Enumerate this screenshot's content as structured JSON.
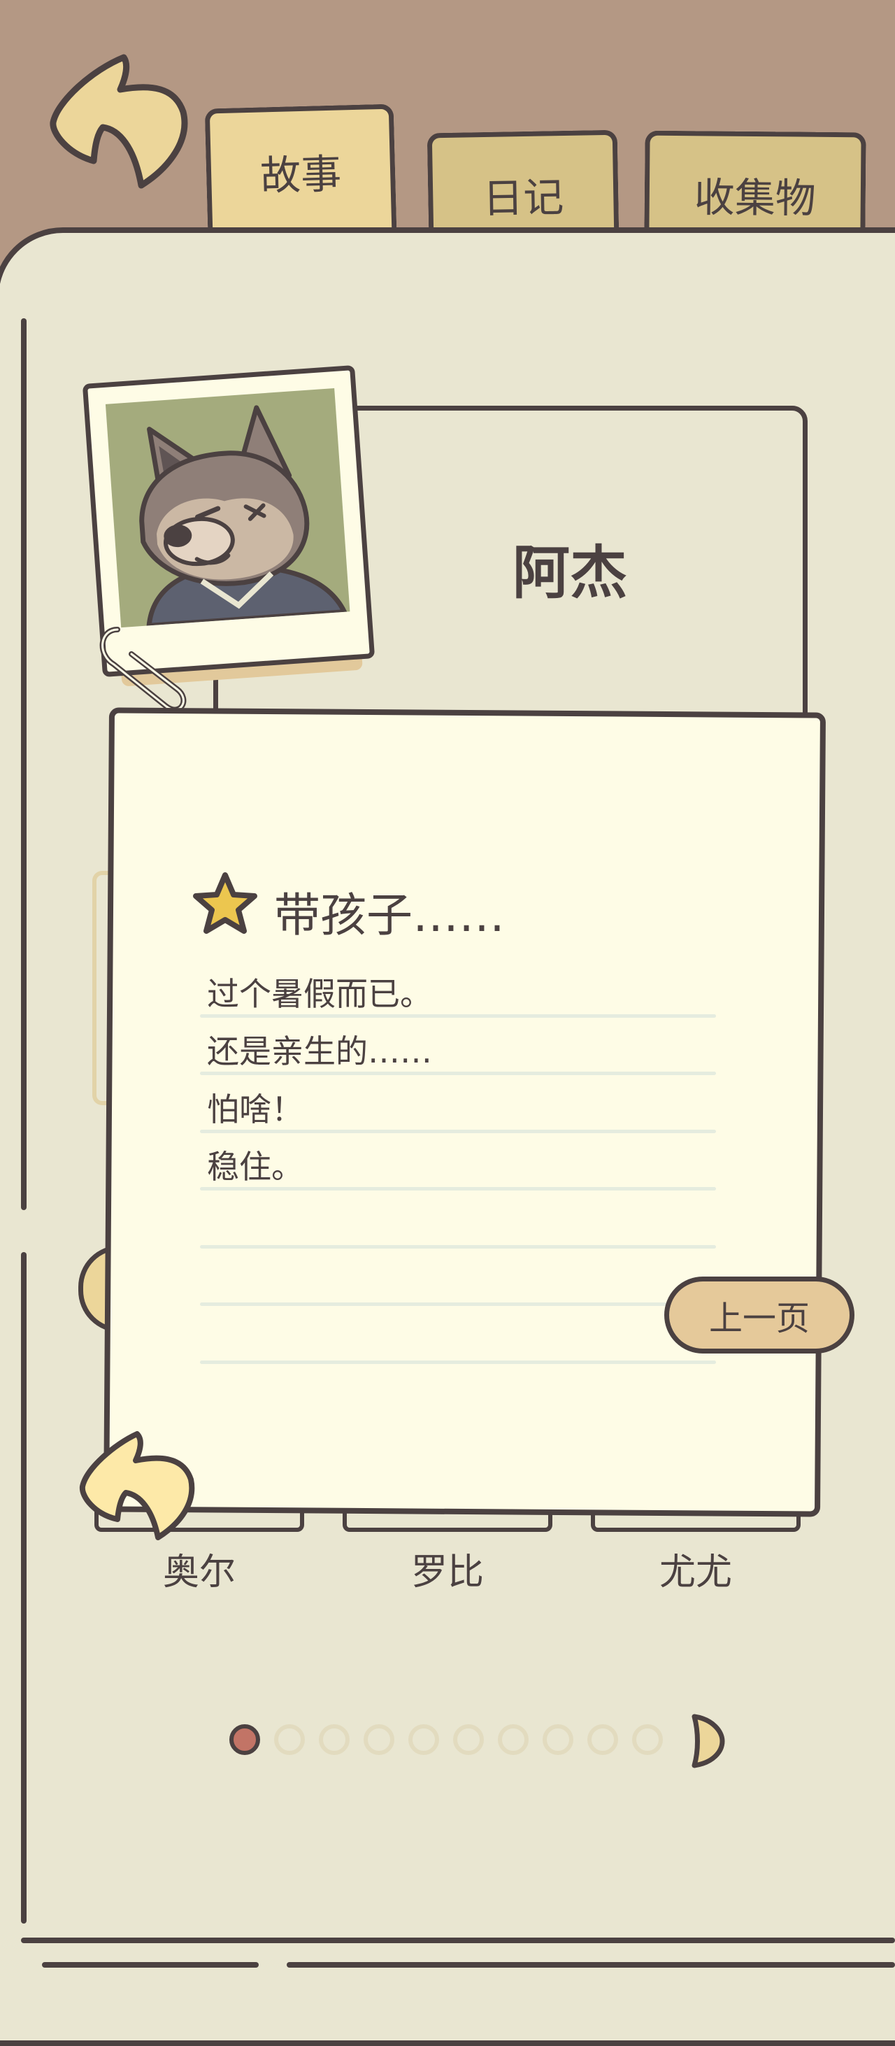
{
  "tabs": [
    {
      "label": "故事",
      "active": true
    },
    {
      "label": "日记",
      "active": false
    },
    {
      "label": "收集物",
      "active": false
    }
  ],
  "character": {
    "name": "阿杰"
  },
  "story": {
    "title": "带孩子……",
    "lines": [
      "过个暑假而已。",
      "还是亲生的……",
      "怕啥！",
      "稳住。"
    ],
    "prev_button": "上一页"
  },
  "characters_row": [
    "奥尔",
    "罗比",
    "尤尤"
  ],
  "pagination": {
    "total": 10,
    "current": 1
  },
  "colors": {
    "outline": "#4b4141",
    "page_bg": "#e9e6d1",
    "paper": "#fefce6",
    "tab_active": "#ecd69a",
    "tab_inactive": "#d6c287",
    "top_band": "#b49884",
    "button": "#e5c99a",
    "dot_active": "#c27466"
  }
}
